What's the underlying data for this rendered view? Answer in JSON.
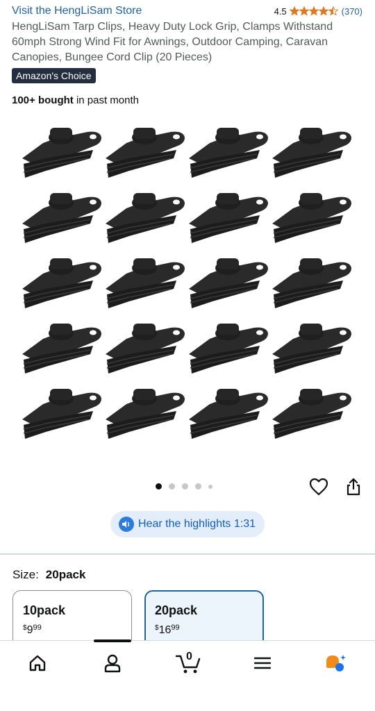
{
  "store": {
    "link": "Visit the HengLiSam Store"
  },
  "rating": {
    "value": "4.5",
    "count": "(370)",
    "stars": 4.5,
    "star_color": "#de7921"
  },
  "product": {
    "title": "HengLiSam Tarp Clips, Heavy Duty Lock Grip, Clamps Withstand 60mph Strong Wind Fit for Awnings, Outdoor Camping, Caravan Canopies, Bungee Cord Clip (20 Pieces)",
    "badge": "Amazon's Choice",
    "bought_bold": "100+ bought",
    "bought_rest": "in past month",
    "image_icon": "black-tarp-clip-icon",
    "image_count": 20
  },
  "gallery": {
    "dots": 5,
    "active": 1
  },
  "actions": {
    "heart_icon": "heart-icon",
    "share_icon": "share-icon"
  },
  "hear": {
    "label": "Hear the highlights 1:31",
    "icon": "audio-play-icon"
  },
  "size": {
    "label": "Size:",
    "selected": "20pack",
    "options": [
      {
        "name": "10pack",
        "currency": "$",
        "dollars": "9",
        "cents": "99"
      },
      {
        "name": "20pack",
        "currency": "$",
        "dollars": "16",
        "cents": "99"
      }
    ]
  },
  "nav": {
    "items": [
      "home-icon",
      "account-icon",
      "cart-icon",
      "menu-icon",
      "rufus-icon"
    ],
    "cart_count": "0",
    "accent": "#f08c1c",
    "rufus_secondary": "#1a73e8"
  },
  "colors": {
    "link": "#2162a1",
    "badge_bg": "#232f3e",
    "selected_border": "#2162a1"
  }
}
